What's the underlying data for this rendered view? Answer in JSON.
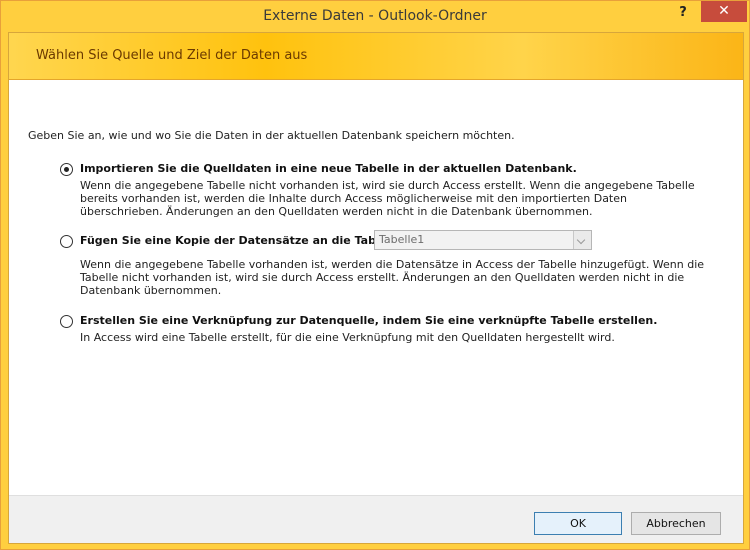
{
  "window": {
    "title": "Externe Daten - Outlook-Ordner",
    "help_label": "?",
    "close_label": "✕"
  },
  "banner": {
    "title": "Wählen Sie Quelle und Ziel der Daten aus"
  },
  "instruction": "Geben Sie an, wie und wo Sie die Daten in der aktuellen Datenbank speichern möchten.",
  "options": [
    {
      "label": "Importieren Sie die Quelldaten in eine neue Tabelle in der aktuellen Datenbank.",
      "description": "Wenn die angegebene Tabelle nicht vorhanden ist, wird sie durch Access erstellt. Wenn die angegebene Tabelle bereits vorhanden ist, werden die Inhalte durch Access möglicherweise mit den importierten Daten überschrieben. Änderungen an den Quelldaten werden nicht in die Datenbank übernommen.",
      "selected": true
    },
    {
      "label": "Fügen Sie eine Kopie der Datensätze an die Tabelle an:",
      "description": "Wenn die angegebene Tabelle vorhanden ist, werden die Datensätze in Access der Tabelle hinzugefügt. Wenn die Tabelle nicht vorhanden ist, wird sie durch Access erstellt. Änderungen an den Quelldaten werden nicht in die Datenbank übernommen.",
      "selected": false,
      "table_select": {
        "value": "Tabelle1",
        "disabled": true
      }
    },
    {
      "label": "Erstellen Sie eine Verknüpfung zur Datenquelle, indem Sie eine verknüpfte Tabelle erstellen.",
      "description": "In Access wird eine Tabelle erstellt, für die eine Verknüpfung mit den Quelldaten hergestellt wird.",
      "selected": false
    }
  ],
  "buttons": {
    "ok": "OK",
    "cancel": "Abbrechen"
  }
}
